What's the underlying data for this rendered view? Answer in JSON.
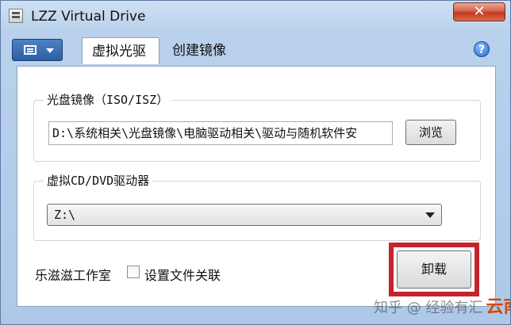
{
  "window": {
    "title": "LZZ Virtual Drive",
    "close_glyph": "✕"
  },
  "toolbar": {
    "menu_icon": "list-icon",
    "tabs": [
      {
        "label": "虚拟光驱",
        "active": true
      },
      {
        "label": "创建镜像",
        "active": false
      }
    ],
    "help_glyph": "?"
  },
  "image_group": {
    "legend": "光盘镜像（ISO/ISZ）",
    "path_value": "D:\\系统相关\\光盘镜像\\电脑驱动相关\\驱动与随机软件安",
    "browse_label": "浏览"
  },
  "drive_group": {
    "legend": "虚拟CD/DVD驱动器",
    "selected_drive": "Z:\\"
  },
  "footer": {
    "studio_label": "乐滋滋工作室",
    "file_assoc_label": "设置文件关联",
    "file_assoc_checked": false,
    "unload_label": "卸载"
  },
  "watermark": {
    "text": "知乎 @ 经验有汇",
    "brand": "云南龙网"
  },
  "colors": {
    "highlight": "#c4242e",
    "accent": "#2c5fa4"
  }
}
